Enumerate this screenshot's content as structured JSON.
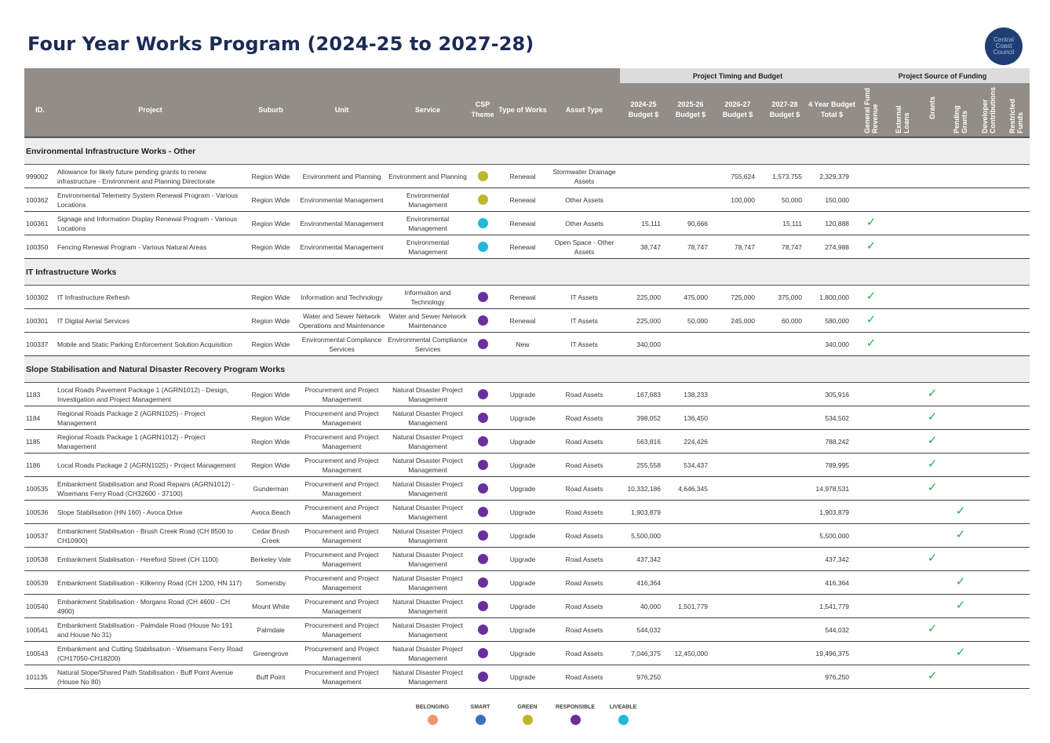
{
  "header": {
    "title": "Four Year Works Program (2024-25 to 2027-28)",
    "logo_lines": [
      "Central",
      "Coast",
      "Council"
    ]
  },
  "table": {
    "group_headers": {
      "timing": "Project Timing and Budget",
      "funding": "Project Source of Funding"
    },
    "columns": {
      "id": "ID.",
      "project": "Project",
      "suburb": "Suburb",
      "unit": "Unit",
      "service": "Service",
      "csp_theme": "CSP Theme",
      "type": "Type of Works",
      "asset": "Asset Type",
      "b2425": "2024-25 Budget $",
      "b2526": "2025-26 Budget $",
      "b2627": "2026-27 Budget $",
      "b2728": "2027-28 Budget $",
      "total": "4 Year Budget Total $",
      "f_general": "General Fund Revenue",
      "f_loans": "External Loans",
      "f_grants": "Grants",
      "f_pending": "Pending Grants",
      "f_developer": "Developer Contributions",
      "f_restricted": "Restricted Funds"
    },
    "tick_symbol": "✓",
    "sections": [
      {
        "title": "Environmental Infrastructure Works - Other",
        "rows": [
          {
            "id": "999002",
            "project": "Allowance for likely future pending grants to renew infrastructure - Environment and Planning Directorate",
            "suburb": "Region Wide",
            "unit": "Environment and Planning",
            "service": "Environment and Planning",
            "theme": "green",
            "type": "Renewal",
            "asset": "Stormwater Drainage Assets",
            "b2425": "",
            "b2526": "",
            "b2627": "755,624",
            "b2728": "1,573,755",
            "total": "2,329,379",
            "fund": ""
          },
          {
            "id": "100362",
            "project": "Environmental Telemetry System Renewal Program - Various Locations",
            "suburb": "Region Wide",
            "unit": "Environmental Management",
            "service": "Environmental Management",
            "theme": "green",
            "type": "Renewal",
            "asset": "Other Assets",
            "b2425": "",
            "b2526": "",
            "b2627": "100,000",
            "b2728": "50,000",
            "total": "150,000",
            "fund": ""
          },
          {
            "id": "100361",
            "project": "Signage and Information Display Renewal Program - Various Locations",
            "suburb": "Region Wide",
            "unit": "Environmental Management",
            "service": "Environmental Management",
            "theme": "liveable",
            "type": "Renewal",
            "asset": "Other Assets",
            "b2425": "15,111",
            "b2526": "90,666",
            "b2627": "",
            "b2728": "15,111",
            "total": "120,888",
            "fund": "general"
          },
          {
            "id": "100350",
            "project": "Fencing Renewal Program - Various Natural Areas",
            "suburb": "Region Wide",
            "unit": "Environmental Management",
            "service": "Environmental Management",
            "theme": "liveable",
            "type": "Renewal",
            "asset": "Open Space - Other Assets",
            "b2425": "38,747",
            "b2526": "78,747",
            "b2627": "78,747",
            "b2728": "78,747",
            "total": "274,988",
            "fund": "general"
          }
        ]
      },
      {
        "title": "IT Infrastructure Works",
        "rows": [
          {
            "id": "100302",
            "project": "IT Infrastructure Refresh",
            "suburb": "Region Wide",
            "unit": "Information and Technology",
            "service": "Information and Technology",
            "theme": "responsible",
            "type": "Renewal",
            "asset": "IT Assets",
            "b2425": "225,000",
            "b2526": "475,000",
            "b2627": "725,000",
            "b2728": "375,000",
            "total": "1,800,000",
            "fund": "general"
          },
          {
            "id": "100301",
            "project": "IT Digital Aerial Services",
            "suburb": "Region Wide",
            "unit": "Water and Sewer Network Operations and Maintenance",
            "service": "Water and Sewer Network Maintenance",
            "theme": "responsible",
            "type": "Renewal",
            "asset": "IT Assets",
            "b2425": "225,000",
            "b2526": "50,000",
            "b2627": "245,000",
            "b2728": "60,000",
            "total": "580,000",
            "fund": "general"
          },
          {
            "id": "100337",
            "project": "Mobile and Static Parking Enforcement Solution Acquisition",
            "suburb": "Region Wide",
            "unit": "Environmental Compliance Services",
            "service": "Environmental Compliance Services",
            "theme": "responsible",
            "type": "New",
            "asset": "IT Assets",
            "b2425": "340,000",
            "b2526": "",
            "b2627": "",
            "b2728": "",
            "total": "340,000",
            "fund": "general"
          }
        ]
      },
      {
        "title": "Slope Stabilisation and Natural Disaster Recovery Program Works",
        "rows": [
          {
            "id": "1183",
            "project": "Local Roads Pavement Package 1 (AGRN1012) - Design, Investigation and Project Management",
            "suburb": "Region Wide",
            "unit": "Procurement and Project Management",
            "service": "Natural Disaster Project Management",
            "theme": "responsible",
            "type": "Upgrade",
            "asset": "Road Assets",
            "b2425": "167,683",
            "b2526": "138,233",
            "b2627": "",
            "b2728": "",
            "total": "305,916",
            "fund": "grants"
          },
          {
            "id": "1184",
            "project": "Regional Roads Package 2 (AGRN1025) - Project Management",
            "suburb": "Region Wide",
            "unit": "Procurement and Project Management",
            "service": "Natural Disaster Project Management",
            "theme": "responsible",
            "type": "Upgrade",
            "asset": "Road Assets",
            "b2425": "398,052",
            "b2526": "136,450",
            "b2627": "",
            "b2728": "",
            "total": "534,502",
            "fund": "grants"
          },
          {
            "id": "1185",
            "project": "Regional Roads Package 1 (AGRN1012) - Project Management",
            "suburb": "Region Wide",
            "unit": "Procurement and Project Management",
            "service": "Natural Disaster Project Management",
            "theme": "responsible",
            "type": "Upgrade",
            "asset": "Road Assets",
            "b2425": "563,816",
            "b2526": "224,426",
            "b2627": "",
            "b2728": "",
            "total": "788,242",
            "fund": "grants"
          },
          {
            "id": "1186",
            "project": "Local Roads Package 2 (AGRN1025) - Project Management",
            "suburb": "Region Wide",
            "unit": "Procurement and Project Management",
            "service": "Natural Disaster Project Management",
            "theme": "responsible",
            "type": "Upgrade",
            "asset": "Road Assets",
            "b2425": "255,558",
            "b2526": "534,437",
            "b2627": "",
            "b2728": "",
            "total": "789,995",
            "fund": "grants"
          },
          {
            "id": "100535",
            "project": "Embankment Stabilisation and Road Repairs (AGRN1012) - Wisemans Ferry Road (CH32600 - 37100)",
            "suburb": "Gunderman",
            "unit": "Procurement and Project Management",
            "service": "Natural Disaster Project Management",
            "theme": "responsible",
            "type": "Upgrade",
            "asset": "Road Assets",
            "b2425": "10,332,186",
            "b2526": "4,646,345",
            "b2627": "",
            "b2728": "",
            "total": "14,978,531",
            "fund": "grants"
          },
          {
            "id": "100536",
            "project": "Slope Stabilisation (HN 160) - Avoca Drive",
            "suburb": "Avoca Beach",
            "unit": "Procurement and Project Management",
            "service": "Natural Disaster Project Management",
            "theme": "responsible",
            "type": "Upgrade",
            "asset": "Road Assets",
            "b2425": "1,903,879",
            "b2526": "",
            "b2627": "",
            "b2728": "",
            "total": "1,903,879",
            "fund": "pending"
          },
          {
            "id": "100537",
            "project": "Embankment Stabilisation - Brush Creek Road (CH 8500 to CH10900)",
            "suburb": "Cedar Brush Creek",
            "unit": "Procurement and Project Management",
            "service": "Natural Disaster Project Management",
            "theme": "responsible",
            "type": "Upgrade",
            "asset": "Road Assets",
            "b2425": "5,500,000",
            "b2526": "",
            "b2627": "",
            "b2728": "",
            "total": "5,500,000",
            "fund": "pending"
          },
          {
            "id": "100538",
            "project": "Embankment Stabilisation - Hereford Street (CH 1100)",
            "suburb": "Berkeley Vale",
            "unit": "Procurement and Project Management",
            "service": "Natural Disaster Project Management",
            "theme": "responsible",
            "type": "Upgrade",
            "asset": "Road Assets",
            "b2425": "437,342",
            "b2526": "",
            "b2627": "",
            "b2728": "",
            "total": "437,342",
            "fund": "grants"
          },
          {
            "id": "100539",
            "project": "Embankment Stabilisation - Kilkenny Road (CH 1200, HN 117)",
            "suburb": "Somersby",
            "unit": "Procurement and Project Management",
            "service": "Natural Disaster Project Management",
            "theme": "responsible",
            "type": "Upgrade",
            "asset": "Road Assets",
            "b2425": "416,364",
            "b2526": "",
            "b2627": "",
            "b2728": "",
            "total": "416,364",
            "fund": "pending"
          },
          {
            "id": "100540",
            "project": "Embankment Stabilisation - Morgans Road (CH 4600 - CH 4900)",
            "suburb": "Mount White",
            "unit": "Procurement and Project Management",
            "service": "Natural Disaster Project Management",
            "theme": "responsible",
            "type": "Upgrade",
            "asset": "Road Assets",
            "b2425": "40,000",
            "b2526": "1,501,779",
            "b2627": "",
            "b2728": "",
            "total": "1,541,779",
            "fund": "pending"
          },
          {
            "id": "100541",
            "project": "Embankment Stabilisation - Palmdale Road (House No 191 and House No 31)",
            "suburb": "Palmdale",
            "unit": "Procurement and Project Management",
            "service": "Natural Disaster Project Management",
            "theme": "responsible",
            "type": "Upgrade",
            "asset": "Road Assets",
            "b2425": "544,032",
            "b2526": "",
            "b2627": "",
            "b2728": "",
            "total": "544,032",
            "fund": "grants"
          },
          {
            "id": "100543",
            "project": "Embankment and Cutting Stabilisation - Wisemans Ferry Road (CH17050-CH18200)",
            "suburb": "Greengrove",
            "unit": "Procurement and Project Management",
            "service": "Natural Disaster Project Management",
            "theme": "responsible",
            "type": "Upgrade",
            "asset": "Road Assets",
            "b2425": "7,046,375",
            "b2526": "12,450,000",
            "b2627": "",
            "b2728": "",
            "total": "19,496,375",
            "fund": "pending"
          },
          {
            "id": "101135",
            "project": "Natural Slope/Shared Path Stabilisation - Buff Point Avenue (House No 80)",
            "suburb": "Buff Point",
            "unit": "Procurement and Project Management",
            "service": "Natural Disaster Project Management",
            "theme": "responsible",
            "type": "Upgrade",
            "asset": "Road Assets",
            "b2425": "976,250",
            "b2526": "",
            "b2627": "",
            "b2728": "",
            "total": "976,250",
            "fund": "grants"
          }
        ]
      }
    ]
  },
  "themes": {
    "belonging": "#f4956b",
    "smart": "#3f6fc2",
    "green": "#bdb72a",
    "responsible": "#6a2f9e",
    "liveable": "#22b8d8"
  },
  "legend": [
    {
      "key": "belonging",
      "label": "BELONGING"
    },
    {
      "key": "smart",
      "label": "SMART"
    },
    {
      "key": "green",
      "label": "GREEN"
    },
    {
      "key": "responsible",
      "label": "RESPONSIBLE"
    },
    {
      "key": "liveable",
      "label": "LIVEABLE"
    }
  ]
}
